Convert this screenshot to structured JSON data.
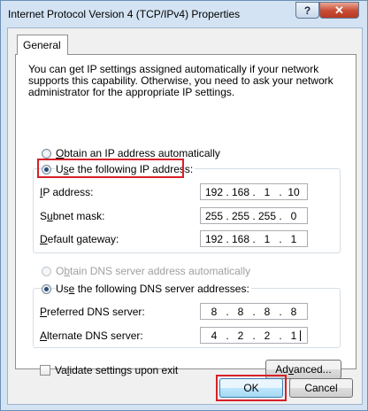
{
  "window": {
    "title": "Internet Protocol Version 4 (TCP/IPv4) Properties",
    "help_glyph": "?",
    "close_glyph": "✕"
  },
  "tabs": [
    {
      "label": "General",
      "selected": true
    }
  ],
  "intro_text": "You can get IP settings assigned automatically if your network supports this capability. Otherwise, you need to ask your network administrator for the appropriate IP settings.",
  "ip_section": {
    "auto_option": {
      "accel": "O",
      "rest": "btain an IP address automatically",
      "checked": false
    },
    "manual_option": {
      "accel": "s",
      "pre": "U",
      "rest": "e the following IP address:",
      "checked": true
    },
    "fields": [
      {
        "accel": "I",
        "pre": "",
        "rest": "P address:",
        "octets": [
          "192",
          "168",
          "1",
          "10"
        ]
      },
      {
        "accel": "u",
        "pre": "S",
        "rest": "bnet mask:",
        "octets": [
          "255",
          "255",
          "255",
          "0"
        ]
      },
      {
        "accel": "D",
        "pre": "",
        "rest": "efault gateway:",
        "octets": [
          "192",
          "168",
          "1",
          "1"
        ]
      }
    ]
  },
  "dns_section": {
    "auto_option": {
      "accel": "b",
      "pre": "O",
      "rest": "tain DNS server address automatically",
      "checked": false,
      "disabled": true
    },
    "manual_option": {
      "accel": "e",
      "pre": "Us",
      "rest": " the following DNS server addresses:",
      "checked": true
    },
    "fields": [
      {
        "accel": "P",
        "pre": "",
        "rest": "referred DNS server:",
        "octets": [
          "8",
          "8",
          "8",
          "8"
        ]
      },
      {
        "accel": "A",
        "pre": "",
        "rest": "lternate DNS server:",
        "octets": [
          "4",
          "2",
          "2",
          "1"
        ]
      }
    ]
  },
  "validate_checkbox": {
    "pre": "Va",
    "accel": "l",
    "rest": "idate settings upon exit",
    "checked": false
  },
  "buttons": {
    "advanced": {
      "pre": "Ad",
      "accel": "v",
      "rest": "anced..."
    },
    "ok": "OK",
    "cancel": "Cancel"
  },
  "highlight_color": "#d7202a"
}
